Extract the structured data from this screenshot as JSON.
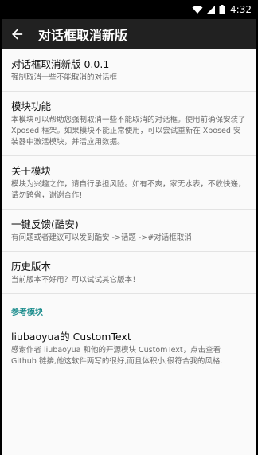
{
  "status": {
    "time": "4:32"
  },
  "toolbar": {
    "title": "对话框取消新版"
  },
  "items": [
    {
      "title": "对话框取消新版 0.0.1",
      "summary": "强制取消一些不能取消的对话框"
    },
    {
      "title": "模块功能",
      "summary": "本模块可以帮助您强制取消一些不能取消的对话框。使用前确保安装了 Xposed 框架。如果模块不能正常使用，可以尝试重新在 Xposed 安装器中激活模块，并活应用数据。"
    },
    {
      "title": "关于模块",
      "summary": "模块为兴趣之作，请自行承担风险。如有不爽，家无水表，不收快递，请勿跨省，谢谢合作!"
    },
    {
      "title": "一键反馈(酷安)",
      "summary": "有问题或者建议可以发到酷安 ->话题 ->#对话框取消"
    },
    {
      "title": "历史版本",
      "summary": "当前版本不好用？可以试试其它版本！"
    }
  ],
  "category": {
    "label": "参考模块"
  },
  "ref_item": {
    "title": "liubaoyua的 CustomText",
    "summary": "感谢作者 liubaoyua 和他的开源模块 CustomText，点击查看 Github 链接,他这软件两写的很好,而且体积小,很符合我的风格."
  },
  "icons": {
    "back": "arrow-back-icon",
    "wifi": "wifi-icon",
    "signal": "signal-icon",
    "battery": "battery-icon"
  }
}
